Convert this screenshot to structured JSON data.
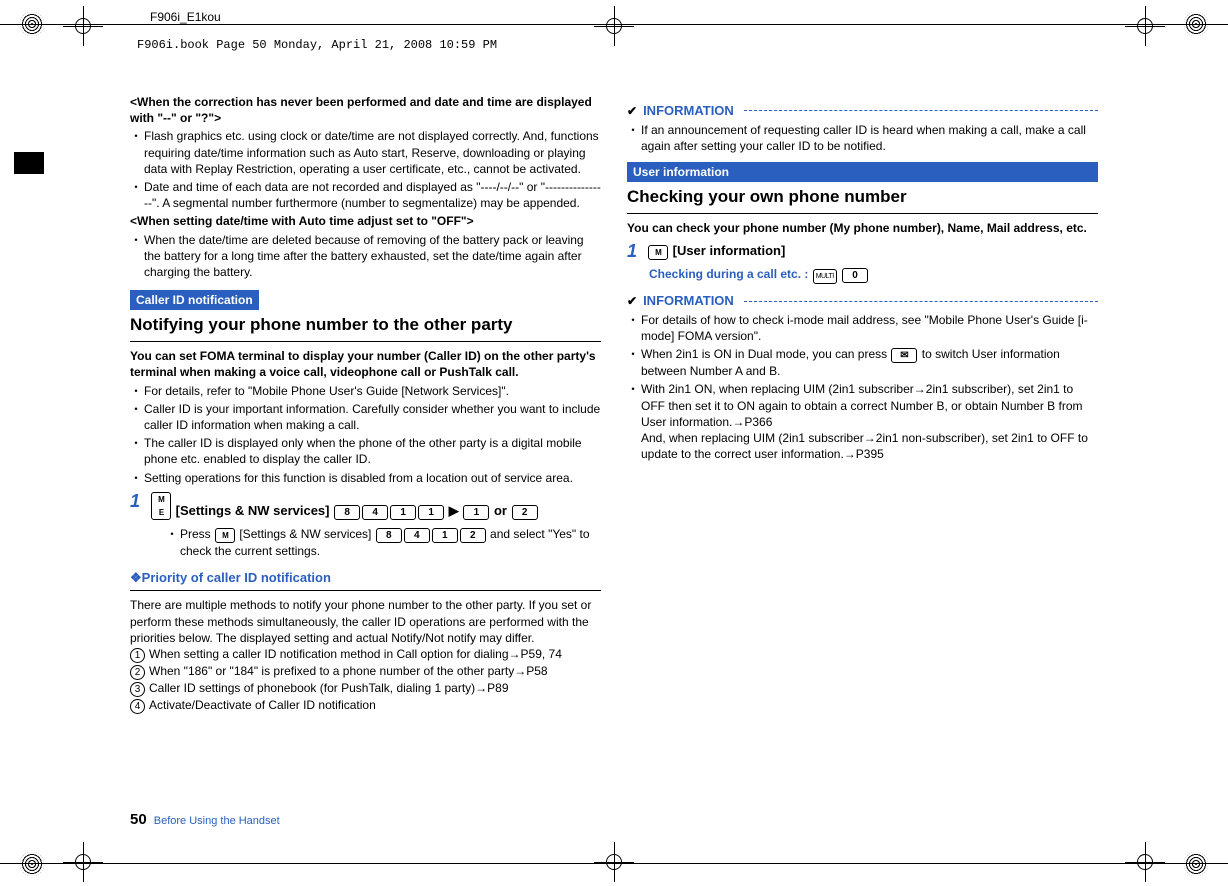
{
  "doc_header": "F906i_E1kou",
  "book_header": "F906i.book  Page 50  Monday, April 21, 2008  10:59 PM",
  "left_col": {
    "when_uncorrected_heading": "<When the correction has never been performed and date and time are displayed with \"--\" or \"?\">",
    "flash_bullet": "Flash graphics etc. using clock or date/time are not displayed correctly. And, functions requiring date/time information such as Auto start, Reserve, downloading or playing data with Replay Restriction, operating a user certificate, etc., cannot be activated.",
    "date_bullet": "Date and time of each data are not recorded and displayed as \"----/--/--\" or \"----------------\". A segmental number furthermore (number to segmentalize) may be appended.",
    "when_off_heading": "<When setting date/time with Auto time adjust set to \"OFF\">",
    "when_off_bullet": "When the date/time are deleted because of removing of the battery pack or leaving the battery for a long time after the battery exhausted, set the date/time again after charging the battery.",
    "caller_band": "Caller ID notification",
    "caller_title": "Notifying your phone number to the other party",
    "caller_intro": "You can set FOMA terminal to display your number (Caller ID) on the other party's terminal when making a voice call, videophone call or PushTalk call.",
    "cb1": "For details, refer to \"Mobile Phone User's Guide [Network Services]\".",
    "cb2": "Caller ID is your important information. Carefully consider whether you want to include caller ID information when making a call.",
    "cb3": "The caller ID is displayed only when the phone of the other party is a digital mobile phone etc. enabled to display the caller ID.",
    "cb4": "Setting operations for this function is disabled from a location out of service area.",
    "step1_prefix": " [Settings & NW services] ",
    "step1_or": " or ",
    "step1_sub_pre": "Press ",
    "step1_sub_mid": " [Settings & NW services] ",
    "step1_sub_post": " and select \"Yes\" to check the current settings.",
    "priority_heading": "Priority of caller ID notification",
    "priority_body": "There are multiple methods to notify your phone number to the other party. If you set or perform these methods simultaneously, the caller ID operations are performed with the priorities below. The displayed setting and actual Notify/Not notify may differ.",
    "pri1": "When setting a caller ID notification method in Call option for dialing→P59, 74",
    "pri2": "When \"186\" or \"184\" is prefixed to a phone number of the other party→P58",
    "pri3": "Caller ID settings of phonebook (for PushTalk, dialing 1 party)→P89",
    "pri4": "Activate/Deactivate of Caller ID notification"
  },
  "right_col": {
    "info_label": "INFORMATION",
    "info1_bullet": "If an announcement of requesting caller ID is heard when making a call, make a call again after setting your caller ID to be notified.",
    "user_band": "User information",
    "user_title": "Checking your own phone number",
    "user_intro": "You can check your phone number (My phone number), Name, Mail address, etc.",
    "step1_text": " [User information]",
    "checking_label": "Checking during a call etc. : ",
    "info2_b1": "For details of how to check i-mode mail address, see \"Mobile Phone User's Guide [i-mode] FOMA version\".",
    "info2_b2_pre": "When 2in1 is ON in Dual mode, you can press ",
    "info2_b2_post": " to switch User information between Number A and B.",
    "info2_b3": "With 2in1 ON, when replacing UIM (2in1 subscriber→2in1 subscriber), set 2in1 to OFF then set it to ON again to obtain a correct Number B, or obtain Number B from User information.→P366",
    "info2_b3b": "And, when replacing UIM (2in1 subscriber→2in1 non-subscriber), set 2in1 to OFF to update to the correct user information.→P395"
  },
  "keys": {
    "menu": "ME\nNU",
    "k8": "8",
    "k4": "4",
    "k1": "1",
    "k2": "2",
    "k0": "0",
    "arrow": "▶",
    "multi": "MULTI",
    "mail": "✉"
  },
  "footer": {
    "page_num": "50",
    "section": "Before Using the Handset"
  }
}
